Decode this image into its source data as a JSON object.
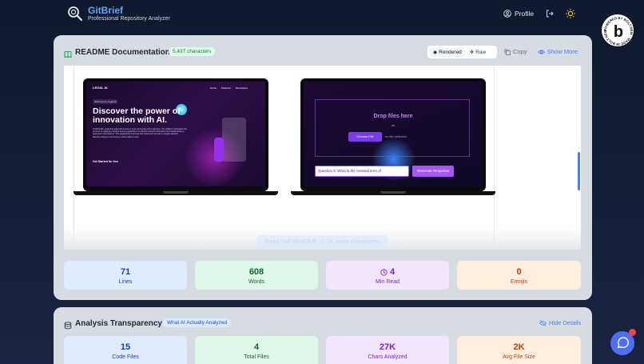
{
  "header": {
    "brand_title": "GitBrief",
    "brand_subtitle": "Professional Repository Analyzer",
    "profile_label": "Profile"
  },
  "readme": {
    "title": "README Documentation",
    "char_badge": "5,437 characters",
    "rendered_label": "Rendered",
    "raw_label": "Raw",
    "copy_label": "Copy",
    "show_more_label": "Show More",
    "read_full_label": "Read Full README (3.7K more characters)",
    "laptop1": {
      "brand": "LEGAL AI",
      "nav": [
        "Home",
        "Features",
        "Developers"
      ],
      "tag": "Welcome to Legal AI",
      "headline": "Discover the power of innovation with AI.",
      "body": "Traditionally, analyzing legal documents is time-consuming and expensive. Our platform automates the process by applying machine learning algorithms to identify relevant information and relationships in legal texts and patterns. This significantly improves the speed and accuracy of legal research, therefore lawyers can focus on what matters most.",
      "cta": "Get Started for free"
    },
    "laptop2": {
      "drop_text": "Drop files here",
      "or_text": "or",
      "choose_label": "Choose File",
      "no_file": "no file selected",
      "question": "Question 6: What is the renewal term of",
      "generate_label": "Generate Response"
    },
    "stats": [
      {
        "value": "71",
        "label": "Lines"
      },
      {
        "value": "608",
        "label": "Words"
      },
      {
        "value": "4",
        "label": "Min Read"
      },
      {
        "value": "0",
        "label": "Emojis"
      }
    ]
  },
  "analysis": {
    "title": "Analysis Transparency",
    "badge": "What AI Actually Analyzed",
    "hide_label": "Hide Details",
    "stats": [
      {
        "value": "15",
        "label": "Code Files"
      },
      {
        "value": "4",
        "label": "Total Files"
      },
      {
        "value": "27K",
        "label": "Chars Analyzed"
      },
      {
        "value": "2K",
        "label": "Avg File Size"
      }
    ]
  },
  "bolt_badge_text": "POWERED BY BOLT.NEW · MADE IN BOLT.NEW ·",
  "bolt_letter": "b",
  "colors": {
    "accent": "#3b82f6",
    "brand": "#60a5fa"
  }
}
